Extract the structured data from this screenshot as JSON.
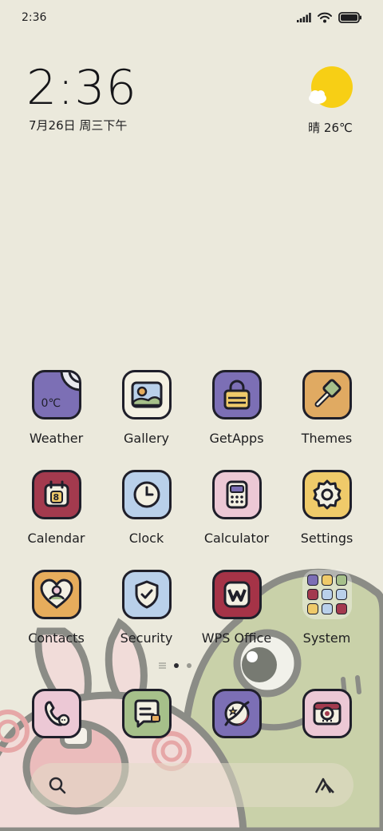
{
  "status_bar": {
    "time": "2:36",
    "icons": [
      "signal-icon",
      "wifi-icon",
      "battery-icon"
    ]
  },
  "clock_widget": {
    "time": "2:36",
    "date": "7月26日 周三下午"
  },
  "weather_widget": {
    "icon": "sun-cloud-icon",
    "text": "晴 26℃"
  },
  "apps": [
    [
      {
        "label": "Weather",
        "icon": "weather-icon",
        "color": "#7c6fb5"
      },
      {
        "label": "Gallery",
        "icon": "gallery-icon",
        "color": "#f3f0e2"
      },
      {
        "label": "GetApps",
        "icon": "getapps-icon",
        "color": "#7c6fb5"
      },
      {
        "label": "Themes",
        "icon": "themes-icon",
        "color": "#e0aa62"
      }
    ],
    [
      {
        "label": "Calendar",
        "icon": "calendar-icon",
        "color": "#a33a4e"
      },
      {
        "label": "Clock",
        "icon": "clock-icon",
        "color": "#b9d0ea"
      },
      {
        "label": "Calculator",
        "icon": "calculator-icon",
        "color": "#ecc8d5"
      },
      {
        "label": "Settings",
        "icon": "settings-icon",
        "color": "#efca6a"
      }
    ],
    [
      {
        "label": "Contacts",
        "icon": "contacts-icon",
        "color": "#e6ac5c"
      },
      {
        "label": "Security",
        "icon": "security-icon",
        "color": "#b9d0ea"
      },
      {
        "label": "WPS Office",
        "icon": "wps-office-icon",
        "color": "#a53347"
      },
      {
        "label": "System",
        "icon": "system-folder-icon",
        "color": "#ffffff"
      }
    ]
  ],
  "weather_icon_text": "0℃",
  "calendar_icon_text": "8",
  "dock": [
    {
      "icon": "phone-icon",
      "color": "#ecc8d5"
    },
    {
      "icon": "messages-icon",
      "color": "#a6c08a"
    },
    {
      "icon": "browser-icon",
      "color": "#7c6fb5"
    },
    {
      "icon": "camera-icon",
      "color": "#ecc8d5"
    }
  ],
  "page_indicator": {
    "pages": 2,
    "current": 1
  },
  "search_bar": {
    "left_icon": "search-icon",
    "right_icon": "assistant-icon"
  }
}
